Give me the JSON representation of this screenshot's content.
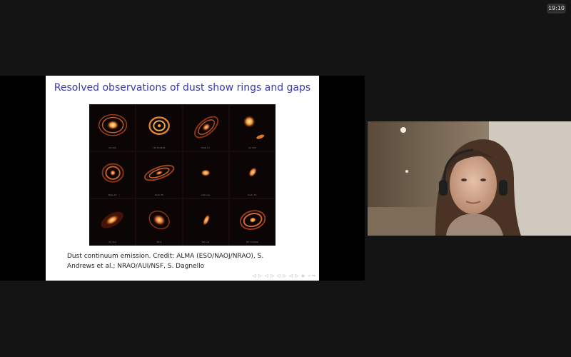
{
  "clock": {
    "time": "19:10"
  },
  "slide": {
    "title": "Resolved observations of dust show rings and gaps",
    "caption_line1": "Dust continuum emission. Credit: ALMA (ESO/NAOJ/NRAO), S.",
    "caption_line2": "Andrews et al.; NRAO/AUI/NSF, S. Dagnello",
    "nav_symbols": "◁ ▷ ◁ ▷ ◁ ▷ ◁ ▷ ≡ ∽∾",
    "disks": [
      {
        "label": "AS 209"
      },
      {
        "label": "HD 163296"
      },
      {
        "label": "Elias 27"
      },
      {
        "label": "AS 205"
      },
      {
        "label": "Elias 24"
      },
      {
        "label": "DoAr 25"
      },
      {
        "label": "GW Lup"
      },
      {
        "label": "DoAr 33"
      },
      {
        "label": "Sz 114"
      },
      {
        "label": "SR 4"
      },
      {
        "label": "RU Lup"
      },
      {
        "label": "HD 143006"
      }
    ]
  },
  "video": {
    "participant": "speaker-webcam"
  },
  "colors": {
    "accent_title": "#3b3bb0",
    "disk_glow": "#f0a040"
  }
}
